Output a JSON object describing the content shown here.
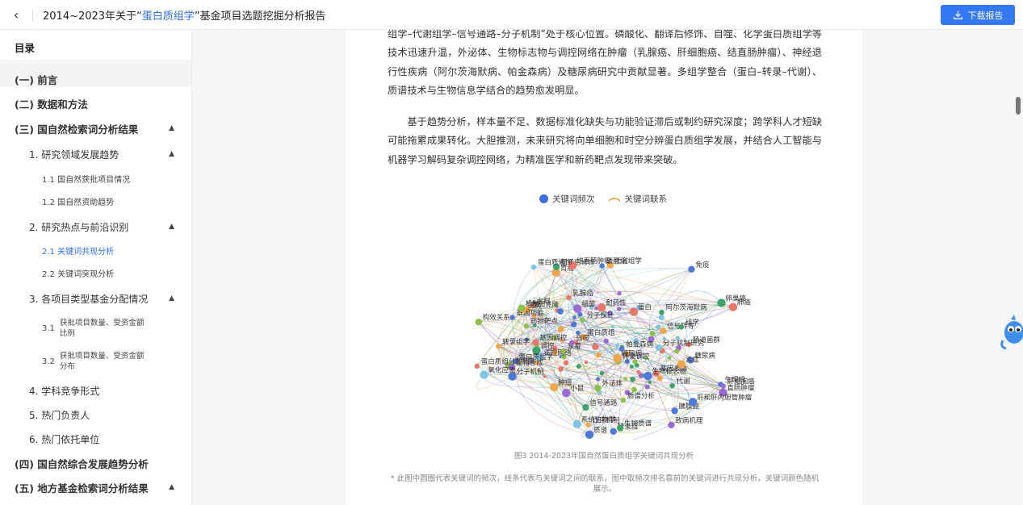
{
  "header": {
    "title_pre": "2014~2023年关于“",
    "title_highlight": "蛋白质组学",
    "title_post": "”基金项目选题挖掘分析报告",
    "download_label": "下载报告"
  },
  "toc": {
    "heading": "目录",
    "items": [
      {
        "label": "(一) 前言"
      },
      {
        "label": "(二) 数据和方法"
      },
      {
        "label": "(三) 国自然检索词分析结果"
      },
      {
        "label": "1. 研究领域发展趋势"
      },
      {
        "label": "1.1  国自然获批项目情况"
      },
      {
        "label": "1.2  国自然资助趋势"
      },
      {
        "label": "2. 研究热点与前沿识别"
      },
      {
        "label": "2.1  关键词共现分析"
      },
      {
        "label": "2.2  关键词突现分析"
      },
      {
        "label": "3. 各项目类型基金分配情况"
      },
      {
        "num": "3.1",
        "line1": "获批项目数量、受资金额",
        "line2": "比例"
      },
      {
        "num": "3.2",
        "line1": "获批项目数量、受资金额",
        "line2": "分布"
      },
      {
        "label": "4. 学科竞争形式"
      },
      {
        "label": "5. 热门负责人"
      },
      {
        "label": "6. 热门依托单位"
      },
      {
        "label": "(四) 国自然综合发展趋势分析"
      },
      {
        "label": "(五) 地方基金检索词分析结果"
      }
    ]
  },
  "content": {
    "para1": "组学–代谢组学–信号通路–分子机制”处于核心位置。磷酸化、翻译后修饰、自噬、化学蛋白质组学等技术迅速升温，外泌体、生物标志物与调控网络在肿瘤（乳腺癌、肝细胞癌、结直肠肿瘤）、神经退行性疾病（阿尔茨海默病、帕金森病）及糖尿病研究中贡献显著。多组学整合（蛋白–转录–代谢）、质谱技术与生物信息学结合的趋势愈发明显。",
    "para2": "基于趋势分析，样本量不足、数据标准化缺失与功能验证滞后或制约研究深度；跨学科人才短缺可能拖累成果转化。大胆推测，未来研究将向单细胞和时空分辨蛋白质组学发展，并结合人工智能与机器学习解码复杂调控网络，为精准医学和新药靶点发现带来突破。",
    "legend_freq": "关键词频次",
    "legend_link": "关键词联系",
    "caption": "图3   2014-2023年国自然蛋白质组学关键词共现分析",
    "note": "* 此图中圆圈代表关键词的频次，线条代表与关键词之间的联系，图中取频次排名靠前的关键词进行共现分析，关键词颜色随机展示。"
  },
  "network": {
    "labels": [
      {
        "t": "转录组学",
        "c": "#f0a64a"
      },
      {
        "t": "基因表达",
        "c": "#e9766a"
      },
      {
        "t": "生物膜",
        "c": "#8bc34a"
      },
      {
        "t": "生理机",
        "c": "#4e79d9"
      },
      {
        "t": "基因克隆",
        "c": "#f0a64a"
      },
      {
        "t": "系统生物学",
        "c": "#7ec5e6"
      },
      {
        "t": "分子探针",
        "c": "#8bc34a"
      },
      {
        "t": "基因调控",
        "c": "#e9766a"
      },
      {
        "t": "细菌",
        "c": "#9c6ad6"
      },
      {
        "t": "基因功能",
        "c": "#4e79d9"
      },
      {
        "t": "转录调控",
        "c": "#8bc34a"
      },
      {
        "t": "肺癌",
        "c": "#e9766a"
      },
      {
        "t": "代谢",
        "c": "#3ea36b"
      },
      {
        "t": "信号转导",
        "c": "#f0a64a"
      },
      {
        "t": "分子机制",
        "c": "#4e79d9"
      },
      {
        "t": "乳腺癌",
        "c": "#e9766a"
      },
      {
        "t": "致病机理",
        "c": "#9c6ad6"
      },
      {
        "t": "调控网络",
        "c": "#7ec5e6"
      },
      {
        "t": "药物靶点",
        "c": "#8bc34a"
      },
      {
        "t": "胰腺癌",
        "c": "#4e79d9"
      },
      {
        "t": "肿瘤",
        "c": "#f0a64a"
      },
      {
        "t": "肝细胞癌",
        "c": "#9c6ad6"
      },
      {
        "t": "转录组",
        "c": "#4e79d9"
      },
      {
        "t": "调控",
        "c": "#3ea36b"
      },
      {
        "t": "水稻",
        "c": "#e9766a"
      },
      {
        "t": "代谢组学",
        "c": "#f0a64a"
      },
      {
        "t": "生物标志物",
        "c": "#4e79d9"
      },
      {
        "t": "家蚕",
        "c": "#8bc34a"
      },
      {
        "t": "糖尿病",
        "c": "#4e79d9"
      },
      {
        "t": "胃癌",
        "c": "#f0a64a"
      },
      {
        "t": "组学",
        "c": "#3ea36b"
      },
      {
        "t": "生物合成",
        "c": "#9c6ad6"
      },
      {
        "t": "氧化应激",
        "c": "#7ec5e6"
      },
      {
        "t": "蛋白质组学",
        "c": "#4e79d9"
      },
      {
        "t": "外泌体",
        "c": "#8bc34a"
      },
      {
        "t": "耐药性",
        "c": "#e9766a"
      },
      {
        "t": "作用机制",
        "c": "#f0a64a"
      },
      {
        "t": "免疫",
        "c": "#4e79d9"
      },
      {
        "t": "卵巢癌",
        "c": "#3ea36b"
      },
      {
        "t": "磷酸化",
        "c": "#4e79d9"
      },
      {
        "t": "蛋白质组",
        "c": "#f0a64a"
      },
      {
        "t": "小鼠",
        "c": "#9c6ad6"
      },
      {
        "t": "质谱分析",
        "c": "#8bc34a"
      },
      {
        "t": "翻译后修饰",
        "c": "#3ea36b"
      },
      {
        "t": "质谱",
        "c": "#4e79d9"
      },
      {
        "t": "肠道菌群",
        "c": "#e9766a"
      },
      {
        "t": "抗病",
        "c": "#f0a64a"
      },
      {
        "t": "直肠肿瘤",
        "c": "#9c6ad6"
      },
      {
        "t": "蛋白质组分析",
        "c": "#e9766a"
      },
      {
        "t": "机制",
        "c": "#8bc34a"
      },
      {
        "t": "肝和肝内胆管肿瘤",
        "c": "#4e79d9"
      },
      {
        "t": "阿尔茨海默病",
        "c": "#3ea36b"
      },
      {
        "t": "分子机制研究",
        "c": "#7ec5e6"
      },
      {
        "t": "结直肠肿瘤",
        "c": "#e9766a"
      },
      {
        "t": "蛋白质修饰",
        "c": "#7ec5e6"
      },
      {
        "t": "生物质谱",
        "c": "#3ea36b"
      },
      {
        "t": "糖尿病",
        "c": "#f0a64a"
      },
      {
        "t": "帕金森病",
        "c": "#4e79d9"
      },
      {
        "t": "构效关系",
        "c": "#8bc34a"
      },
      {
        "t": "蛋白",
        "c": "#e9766a"
      },
      {
        "t": "自噬",
        "c": "#9c6ad6"
      },
      {
        "t": "信号通路",
        "c": "#3ea36b"
      },
      {
        "t": "炎症",
        "c": "#f0a64a"
      }
    ]
  }
}
